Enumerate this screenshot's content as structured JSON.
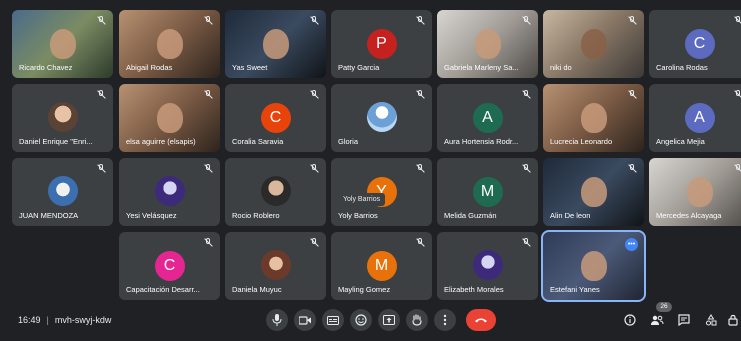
{
  "colors": {
    "background": "#202124",
    "tile": "#3c4043",
    "end_call": "#ea4335",
    "accent": "#8ab4f8"
  },
  "participants": [
    {
      "name": "Ricardo Chavez"
    },
    {
      "name": "Abigail Rodas"
    },
    {
      "name": "Yas Sweet"
    },
    {
      "name": "Patty Garcia",
      "initial": "P",
      "color": "#c5221f"
    },
    {
      "name": "Gabriela Marleny Sa..."
    },
    {
      "name": "niki do"
    },
    {
      "name": "Carolina Rodas",
      "initial": "C",
      "color": "#5c6bc0"
    },
    {
      "name": "Daniel Enrique \"Enri..."
    },
    {
      "name": "elsa aguirre (elsapis)"
    },
    {
      "name": "Coralia Saravia",
      "initial": "C",
      "color": "#e8430a"
    },
    {
      "name": "Gloria"
    },
    {
      "name": "Aura Hortensia Rodr...",
      "initial": "A",
      "color": "#1e6b52"
    },
    {
      "name": "Lucrecia Leonardo"
    },
    {
      "name": "Angelica Mejia",
      "initial": "A",
      "color": "#5c6bc0"
    },
    {
      "name": "JUAN MENDOZA"
    },
    {
      "name": "Yesi Velásquez"
    },
    {
      "name": "Rocio Roblero"
    },
    {
      "name": "Yoly Barrios",
      "initial": "Y",
      "color": "#e8710a"
    },
    {
      "name": "Melida Guzmán",
      "initial": "M",
      "color": "#1e6b52"
    },
    {
      "name": "Alin De leon"
    },
    {
      "name": "Mercedes Alcayaga"
    },
    {
      "name": "Capacitación Desarr...",
      "initial": "C",
      "color": "#e52592"
    },
    {
      "name": "Daniela Muyuc"
    },
    {
      "name": "Mayling Gomez",
      "initial": "M",
      "color": "#e8710a"
    },
    {
      "name": "Elizabeth Morales"
    },
    {
      "name": "Estefani Yanes"
    }
  ],
  "tooltip": "Yoly Barrios",
  "meeting": {
    "time": "16:49",
    "separator": "|",
    "code": "mvh-swyj-kdw"
  },
  "controls": [
    "mic-icon",
    "camera-icon",
    "captions-icon",
    "emoji-icon",
    "present-icon",
    "hand-icon",
    "more-options-icon",
    "end-call-icon"
  ],
  "right_controls": [
    "info-icon",
    "people-icon",
    "chat-icon",
    "activities-icon",
    "lock-icon"
  ],
  "participant_count": "26"
}
